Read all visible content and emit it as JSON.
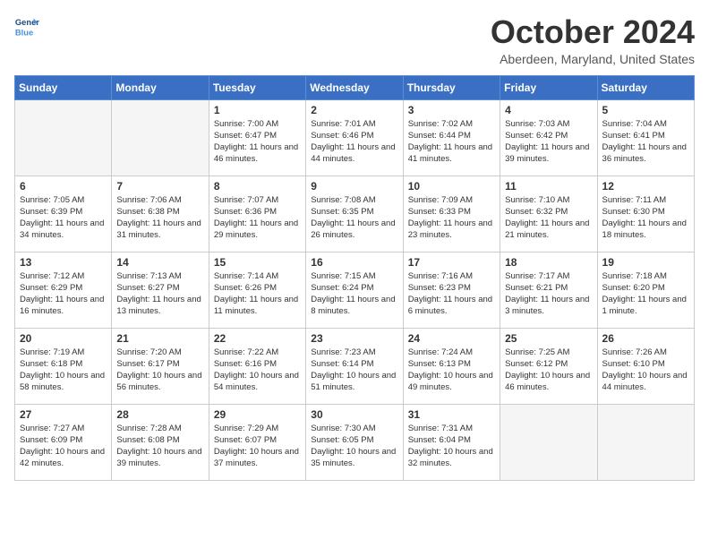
{
  "header": {
    "logo_line1": "General",
    "logo_line2": "Blue",
    "month": "October 2024",
    "location": "Aberdeen, Maryland, United States"
  },
  "weekdays": [
    "Sunday",
    "Monday",
    "Tuesday",
    "Wednesday",
    "Thursday",
    "Friday",
    "Saturday"
  ],
  "weeks": [
    [
      {
        "day": "",
        "empty": true
      },
      {
        "day": "",
        "empty": true
      },
      {
        "day": "1",
        "sunrise": "7:00 AM",
        "sunset": "6:47 PM",
        "daylight": "11 hours and 46 minutes."
      },
      {
        "day": "2",
        "sunrise": "7:01 AM",
        "sunset": "6:46 PM",
        "daylight": "11 hours and 44 minutes."
      },
      {
        "day": "3",
        "sunrise": "7:02 AM",
        "sunset": "6:44 PM",
        "daylight": "11 hours and 41 minutes."
      },
      {
        "day": "4",
        "sunrise": "7:03 AM",
        "sunset": "6:42 PM",
        "daylight": "11 hours and 39 minutes."
      },
      {
        "day": "5",
        "sunrise": "7:04 AM",
        "sunset": "6:41 PM",
        "daylight": "11 hours and 36 minutes."
      }
    ],
    [
      {
        "day": "6",
        "sunrise": "7:05 AM",
        "sunset": "6:39 PM",
        "daylight": "11 hours and 34 minutes."
      },
      {
        "day": "7",
        "sunrise": "7:06 AM",
        "sunset": "6:38 PM",
        "daylight": "11 hours and 31 minutes."
      },
      {
        "day": "8",
        "sunrise": "7:07 AM",
        "sunset": "6:36 PM",
        "daylight": "11 hours and 29 minutes."
      },
      {
        "day": "9",
        "sunrise": "7:08 AM",
        "sunset": "6:35 PM",
        "daylight": "11 hours and 26 minutes."
      },
      {
        "day": "10",
        "sunrise": "7:09 AM",
        "sunset": "6:33 PM",
        "daylight": "11 hours and 23 minutes."
      },
      {
        "day": "11",
        "sunrise": "7:10 AM",
        "sunset": "6:32 PM",
        "daylight": "11 hours and 21 minutes."
      },
      {
        "day": "12",
        "sunrise": "7:11 AM",
        "sunset": "6:30 PM",
        "daylight": "11 hours and 18 minutes."
      }
    ],
    [
      {
        "day": "13",
        "sunrise": "7:12 AM",
        "sunset": "6:29 PM",
        "daylight": "11 hours and 16 minutes."
      },
      {
        "day": "14",
        "sunrise": "7:13 AM",
        "sunset": "6:27 PM",
        "daylight": "11 hours and 13 minutes."
      },
      {
        "day": "15",
        "sunrise": "7:14 AM",
        "sunset": "6:26 PM",
        "daylight": "11 hours and 11 minutes."
      },
      {
        "day": "16",
        "sunrise": "7:15 AM",
        "sunset": "6:24 PM",
        "daylight": "11 hours and 8 minutes."
      },
      {
        "day": "17",
        "sunrise": "7:16 AM",
        "sunset": "6:23 PM",
        "daylight": "11 hours and 6 minutes."
      },
      {
        "day": "18",
        "sunrise": "7:17 AM",
        "sunset": "6:21 PM",
        "daylight": "11 hours and 3 minutes."
      },
      {
        "day": "19",
        "sunrise": "7:18 AM",
        "sunset": "6:20 PM",
        "daylight": "11 hours and 1 minute."
      }
    ],
    [
      {
        "day": "20",
        "sunrise": "7:19 AM",
        "sunset": "6:18 PM",
        "daylight": "10 hours and 58 minutes."
      },
      {
        "day": "21",
        "sunrise": "7:20 AM",
        "sunset": "6:17 PM",
        "daylight": "10 hours and 56 minutes."
      },
      {
        "day": "22",
        "sunrise": "7:22 AM",
        "sunset": "6:16 PM",
        "daylight": "10 hours and 54 minutes."
      },
      {
        "day": "23",
        "sunrise": "7:23 AM",
        "sunset": "6:14 PM",
        "daylight": "10 hours and 51 minutes."
      },
      {
        "day": "24",
        "sunrise": "7:24 AM",
        "sunset": "6:13 PM",
        "daylight": "10 hours and 49 minutes."
      },
      {
        "day": "25",
        "sunrise": "7:25 AM",
        "sunset": "6:12 PM",
        "daylight": "10 hours and 46 minutes."
      },
      {
        "day": "26",
        "sunrise": "7:26 AM",
        "sunset": "6:10 PM",
        "daylight": "10 hours and 44 minutes."
      }
    ],
    [
      {
        "day": "27",
        "sunrise": "7:27 AM",
        "sunset": "6:09 PM",
        "daylight": "10 hours and 42 minutes."
      },
      {
        "day": "28",
        "sunrise": "7:28 AM",
        "sunset": "6:08 PM",
        "daylight": "10 hours and 39 minutes."
      },
      {
        "day": "29",
        "sunrise": "7:29 AM",
        "sunset": "6:07 PM",
        "daylight": "10 hours and 37 minutes."
      },
      {
        "day": "30",
        "sunrise": "7:30 AM",
        "sunset": "6:05 PM",
        "daylight": "10 hours and 35 minutes."
      },
      {
        "day": "31",
        "sunrise": "7:31 AM",
        "sunset": "6:04 PM",
        "daylight": "10 hours and 32 minutes."
      },
      {
        "day": "",
        "empty": true
      },
      {
        "day": "",
        "empty": true
      }
    ]
  ]
}
